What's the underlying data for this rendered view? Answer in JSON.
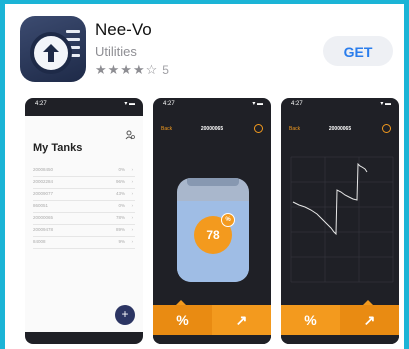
{
  "app": {
    "name": "Nee-Vo",
    "category": "Utilities",
    "stars_filled": "★★★★",
    "stars_empty": "☆",
    "rating_count": "5",
    "get_label": "GET"
  },
  "colors": {
    "accent": "#f39a1e",
    "get_text": "#2a7dec",
    "background": "#1bb4d6"
  },
  "status": {
    "time": "4:27",
    "signal": "▾ ▬"
  },
  "screen1": {
    "title": "My Tanks",
    "person_icon": "person-settings-icon",
    "rows": [
      {
        "id": "20008450",
        "value": "0%"
      },
      {
        "id": "20002284",
        "value": "96%"
      },
      {
        "id": "20009077",
        "value": "43%"
      },
      {
        "id": "860051",
        "value": "0%"
      },
      {
        "id": "20000065",
        "value": "78%"
      },
      {
        "id": "20009478",
        "value": "89%"
      },
      {
        "id": "84008",
        "value": "9%"
      }
    ],
    "add_label": "+"
  },
  "screen2": {
    "back": "Back",
    "tank_id": "20000065",
    "level_value": 78,
    "level_label": "78",
    "pct_symbol": "%",
    "tab_percent": "%",
    "tab_chart": "↗"
  },
  "screen3": {
    "back": "Back",
    "tank_id": "20000065",
    "tab_percent": "%",
    "tab_chart": "↗"
  }
}
